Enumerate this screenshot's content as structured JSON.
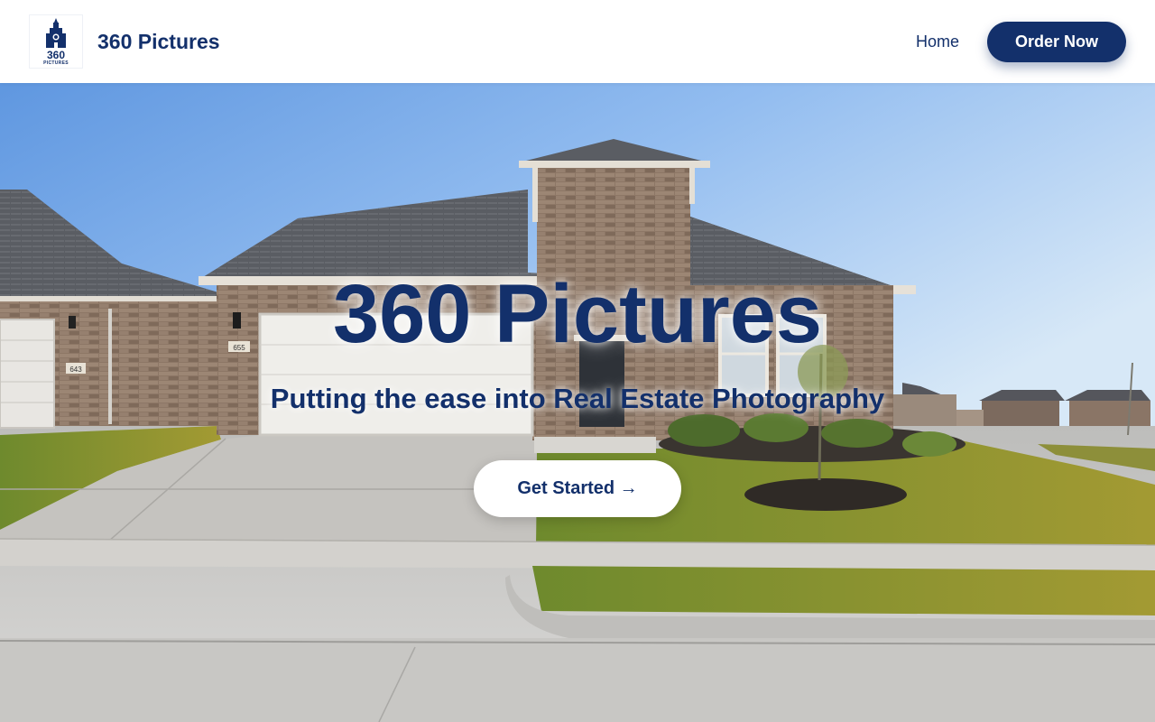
{
  "header": {
    "logo": {
      "icon": "building-tower-icon",
      "text_top": "360",
      "text_bottom": "PICTURES"
    },
    "brand_name": "360 Pictures",
    "nav": {
      "home_label": "Home"
    },
    "order_label": "Order Now"
  },
  "hero": {
    "title": "360 Pictures",
    "subtitle": "Putting the ease into Real Estate Photography",
    "cta_label": "Get Started →",
    "house_numbers": {
      "left": "643",
      "main": "655"
    }
  },
  "colors": {
    "brand_navy": "#13306b",
    "button_text": "#ffffff",
    "cta_bg": "#ffffff"
  }
}
